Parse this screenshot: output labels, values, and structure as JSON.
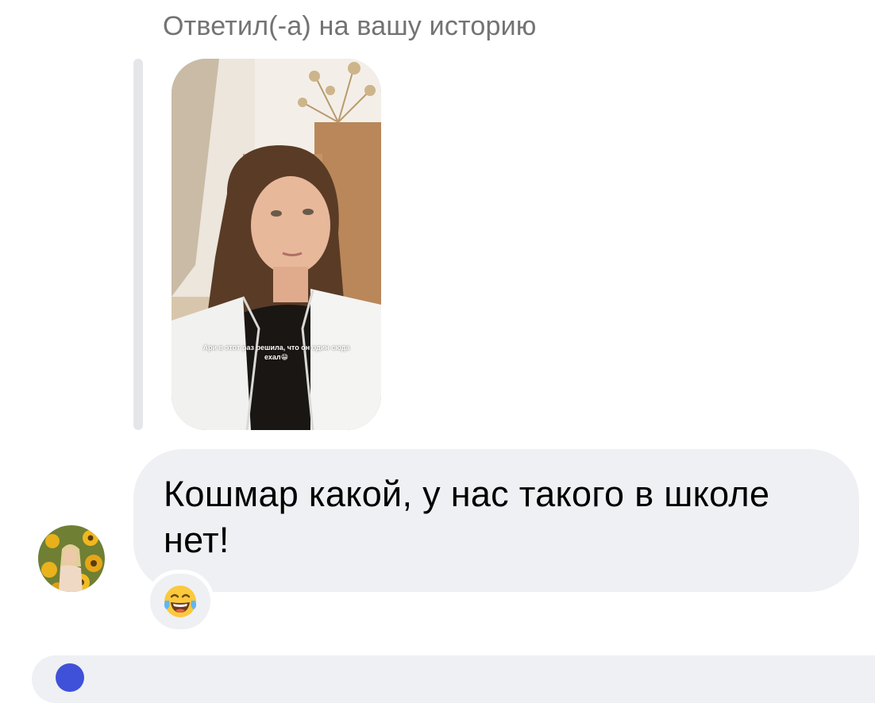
{
  "story_reply": {
    "caption": "Ответил(-а) на вашу историю",
    "story_overlay_text": "Ари в этот раз решила, что он один сюда ехал😁"
  },
  "message": {
    "text": "Кошмар какой, у нас такого в школе нет!",
    "reaction": "😂",
    "reaction_icon": "face-with-tears-of-joy-icon"
  },
  "colors": {
    "bubble_background": "#eff0f3",
    "caption_text": "#737373",
    "quote_bar": "#e4e6ea",
    "composer_icon": "#3f51d8"
  }
}
